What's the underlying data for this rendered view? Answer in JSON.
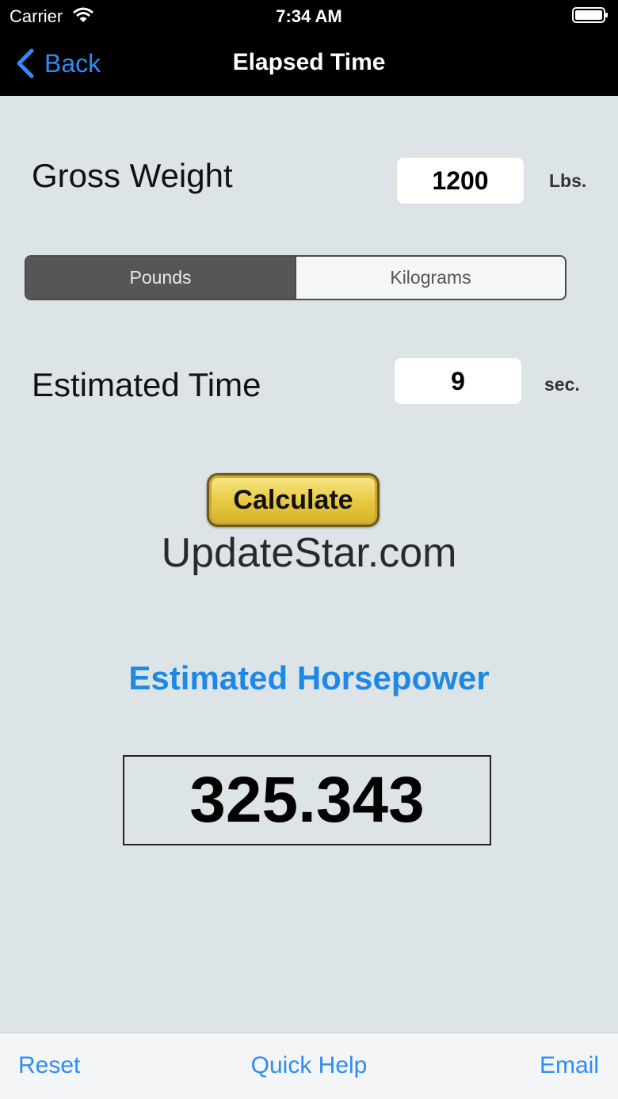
{
  "status_bar": {
    "carrier": "Carrier",
    "time": "7:34 AM"
  },
  "nav": {
    "back_label": "Back",
    "title": "Elapsed Time"
  },
  "gross_weight": {
    "label": "Gross Weight",
    "value": "1200",
    "unit": "Lbs."
  },
  "unit_toggle": {
    "pounds_label": "Pounds",
    "kilograms_label": "Kilograms",
    "selected": "Pounds"
  },
  "estimated_time": {
    "label": "Estimated Time",
    "value": "9",
    "unit": "sec."
  },
  "calculate_label": "Calculate",
  "watermark": "UpdateStar.com",
  "result": {
    "title": "Estimated Horsepower",
    "value": "325.343"
  },
  "bottom_bar": {
    "reset_label": "Reset",
    "help_label": "Quick Help",
    "email_label": "Email"
  },
  "colors": {
    "accent": "#2f8cf6",
    "result_title": "#1e88e5",
    "background": "#dde4e7"
  }
}
